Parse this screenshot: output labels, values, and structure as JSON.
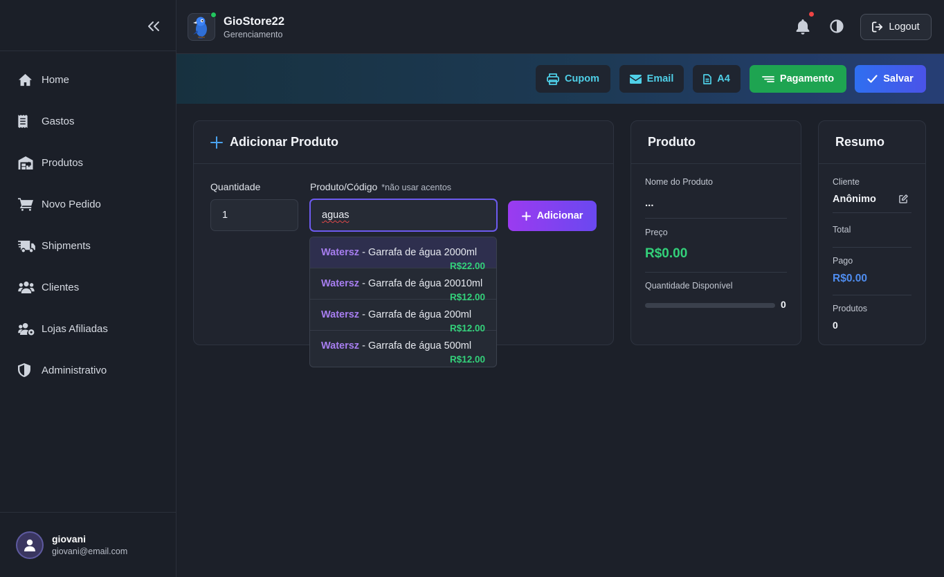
{
  "sidebar": {
    "items": [
      {
        "label": "Home",
        "icon": "home-icon"
      },
      {
        "label": "Gastos",
        "icon": "receipt-icon"
      },
      {
        "label": "Produtos",
        "icon": "warehouse-icon"
      },
      {
        "label": "Novo Pedido",
        "icon": "cart-icon"
      },
      {
        "label": "Shipments",
        "icon": "truck-icon"
      },
      {
        "label": "Clientes",
        "icon": "users-icon"
      },
      {
        "label": "Lojas Afiliadas",
        "icon": "users-gear-icon"
      },
      {
        "label": "Administrativo",
        "icon": "shield-icon"
      }
    ],
    "user": {
      "name": "giovani",
      "email": "giovani@email.com"
    }
  },
  "header": {
    "store_name": "GioStore22",
    "store_subtitle": "Gerenciamento",
    "logout_label": "Logout"
  },
  "actions": {
    "cupom": "Cupom",
    "email": "Email",
    "a4": "A4",
    "pagamento": "Pagamento",
    "salvar": "Salvar"
  },
  "add_product": {
    "title": "Adicionar Produto",
    "qty_label": "Quantidade",
    "qty_value": "1",
    "product_label": "Produto/Código",
    "product_note": "*não usar acentos",
    "product_value": "aguas",
    "add_label": "Adicionar",
    "suggestions": [
      {
        "brand": "Watersz",
        "name": " - Garrafa de água 2000ml",
        "price": "R$22.00"
      },
      {
        "brand": "Watersz",
        "name": " - Garrafa de água 20010ml",
        "price": "R$12.00"
      },
      {
        "brand": "Watersz",
        "name": " - Garrafa de água 200ml",
        "price": "R$12.00"
      },
      {
        "brand": "Watersz",
        "name": " - Garrafa de água 500ml",
        "price": "R$12.00"
      }
    ]
  },
  "product": {
    "title": "Produto",
    "name_label": "Nome do Produto",
    "name_value": "...",
    "price_label": "Preço",
    "price_value": "R$0.00",
    "stock_label": "Quantidade Disponível",
    "stock_value": "0"
  },
  "summary": {
    "title": "Resumo",
    "client_label": "Cliente",
    "client_value": "Anônimo",
    "total_label": "Total",
    "paid_label": "Pago",
    "paid_value": "R$0.00",
    "products_label": "Produtos",
    "products_value": "0"
  },
  "colors": {
    "accent_purple": "#7c4df0",
    "price_green": "#33d17a",
    "paid_blue": "#4f8df0",
    "pagamento_green": "#1ea451",
    "cyan_text": "#4fd0e8"
  }
}
